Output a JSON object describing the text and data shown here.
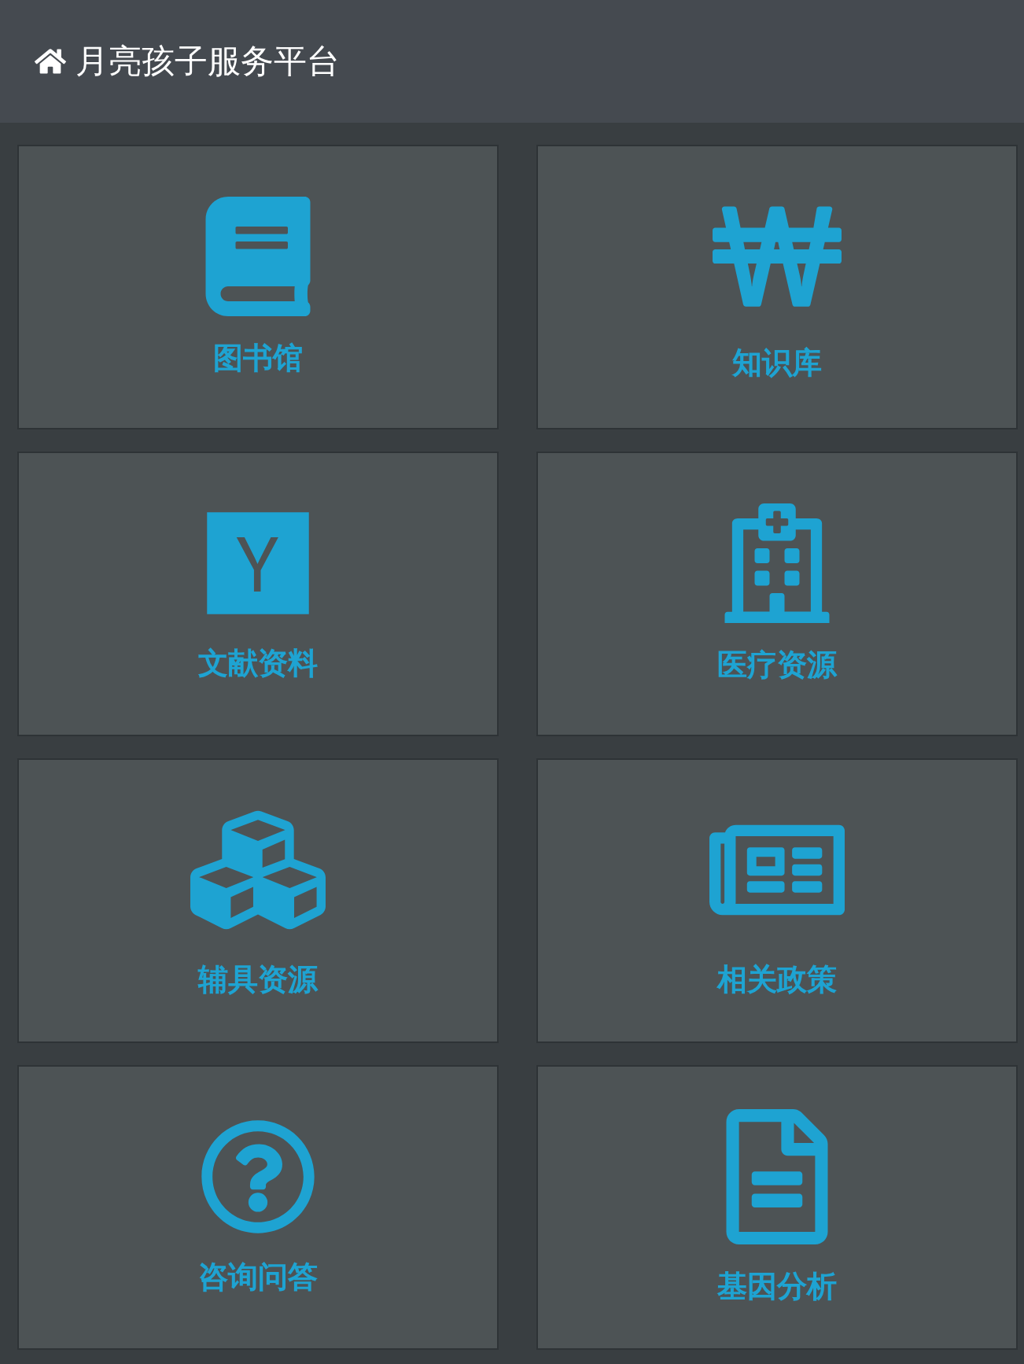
{
  "header": {
    "title": "月亮孩子服务平台"
  },
  "tiles": [
    {
      "label": "图书馆"
    },
    {
      "label": "知识库"
    },
    {
      "label": "文献资料"
    },
    {
      "label": "医疗资源"
    },
    {
      "label": "辅具资源"
    },
    {
      "label": "相关政策"
    },
    {
      "label": "咨询问答"
    },
    {
      "label": "基因分析"
    }
  ]
}
